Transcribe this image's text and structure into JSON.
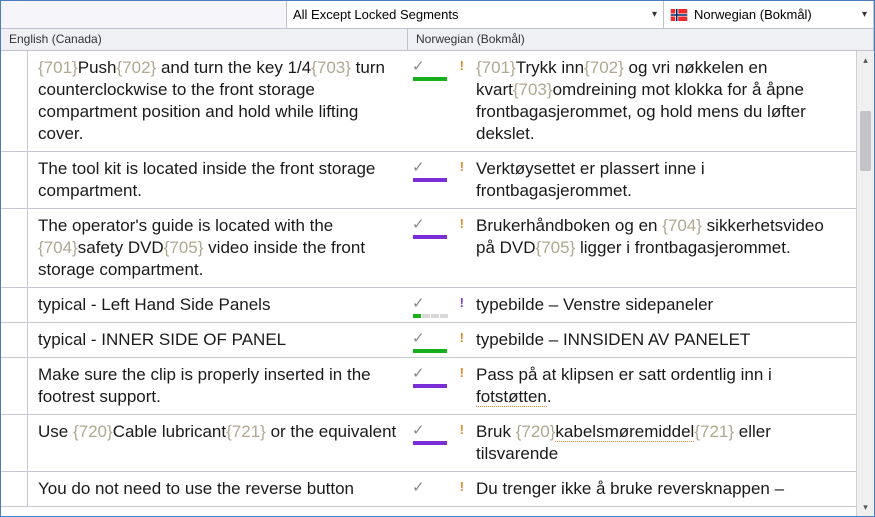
{
  "toolbar": {
    "filterDropdown": "All Except Locked Segments",
    "languageDropdown": "Norwegian (Bokmål)"
  },
  "headers": {
    "source": "English (Canada)",
    "target": "Norwegian (Bokmål)"
  },
  "segments": [
    {
      "src": [
        {
          "t": "tag",
          "v": "{701}"
        },
        {
          "t": "txt",
          "v": "Push"
        },
        {
          "t": "tag",
          "v": "{702}"
        },
        {
          "t": "txt",
          "v": " and turn the key 1/4"
        },
        {
          "t": "tag",
          "v": "{703}"
        },
        {
          "t": "txt",
          "v": " turn counterclockwise to the front storage compartment position and hold while lifting cover."
        }
      ],
      "tgt": [
        {
          "t": "tag",
          "v": "{701}"
        },
        {
          "t": "txt",
          "v": "Trykk inn"
        },
        {
          "t": "tag",
          "v": "{702}"
        },
        {
          "t": "txt",
          "v": " og vri nøkkelen en kvart"
        },
        {
          "t": "tag",
          "v": "{703}"
        },
        {
          "t": "txt",
          "v": "omdreining mot klokka for å åpne frontbagasjerommet, og hold mens du løfter dekslet."
        }
      ],
      "bar": "green",
      "excl": "orange"
    },
    {
      "src": [
        {
          "t": "txt",
          "v": "The tool kit is located inside the front storage compartment."
        }
      ],
      "tgt": [
        {
          "t": "txt",
          "v": "Verktøysettet er plassert inne i frontbagasjerommet."
        }
      ],
      "bar": "purple",
      "excl": "orange"
    },
    {
      "src": [
        {
          "t": "txt",
          "v": "The operator's guide is located with the "
        },
        {
          "t": "tag",
          "v": "{704}"
        },
        {
          "t": "txt",
          "v": "safety DVD"
        },
        {
          "t": "tag",
          "v": "{705}"
        },
        {
          "t": "txt",
          "v": " video inside the front storage compartment."
        }
      ],
      "tgt": [
        {
          "t": "txt",
          "v": "Brukerhåndboken og en "
        },
        {
          "t": "tag",
          "v": "{704}"
        },
        {
          "t": "txt",
          "v": " sikkerhetsvideo på DVD"
        },
        {
          "t": "tag",
          "v": "{705}"
        },
        {
          "t": "txt",
          "v": " ligger i frontbagasjerommet."
        }
      ],
      "bar": "purple",
      "excl": "orange"
    },
    {
      "src": [
        {
          "t": "txt",
          "v": "typical - Left Hand Side Panels"
        }
      ],
      "tgt": [
        {
          "t": "txt",
          "v": "typebilde – Venstre sidepaneler"
        }
      ],
      "bar": "partial",
      "excl": "purple"
    },
    {
      "src": [
        {
          "t": "txt",
          "v": "typical - INNER SIDE OF PANEL"
        }
      ],
      "tgt": [
        {
          "t": "txt",
          "v": "typebilde – INNSIDEN AV PANELET"
        }
      ],
      "bar": "green",
      "excl": "orange"
    },
    {
      "src": [
        {
          "t": "txt",
          "v": "Make sure the clip is properly inserted in the footrest support."
        }
      ],
      "tgt": [
        {
          "t": "txt",
          "v": "Pass på at klipsen er satt ordentlig inn i "
        },
        {
          "t": "under",
          "v": "fotstøtten"
        },
        {
          "t": "txt",
          "v": "."
        }
      ],
      "bar": "purple",
      "excl": "orange"
    },
    {
      "src": [
        {
          "t": "txt",
          "v": "Use "
        },
        {
          "t": "tag",
          "v": "{720}"
        },
        {
          "t": "txt",
          "v": "Cable lubricant"
        },
        {
          "t": "tag",
          "v": "{721}"
        },
        {
          "t": "txt",
          "v": " or the equivalent"
        }
      ],
      "tgt": [
        {
          "t": "txt",
          "v": "Bruk "
        },
        {
          "t": "tag",
          "v": "{720}"
        },
        {
          "t": "under",
          "v": "kabelsmøremiddel"
        },
        {
          "t": "tag",
          "v": "{721}"
        },
        {
          "t": "txt",
          "v": " eller tilsvarende"
        }
      ],
      "bar": "purple",
      "excl": "orange"
    },
    {
      "src": [
        {
          "t": "txt",
          "v": "You do not need to use the reverse button"
        }
      ],
      "tgt": [
        {
          "t": "txt",
          "v": "Du trenger ikke å bruke reversknappen –"
        }
      ],
      "bar": "none",
      "excl": "orange"
    }
  ]
}
